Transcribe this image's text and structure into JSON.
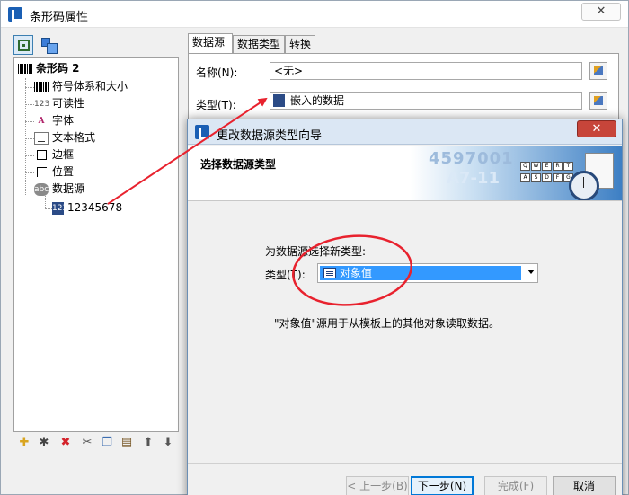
{
  "main_window": {
    "title": "条形码属性",
    "close_glyph": "✕"
  },
  "tree": {
    "root": "条形码 2",
    "items": [
      "符号体系和大小",
      "可读性",
      "字体",
      "文本格式",
      "边框",
      "位置",
      "数据源"
    ],
    "child": "12345678",
    "icon_labels": {
      "readability": "123",
      "font": "A",
      "datasource": "abc",
      "child_doc": "123"
    }
  },
  "tree_bottom_icons": [
    "new-icon",
    "wizard-icon",
    "delete-icon",
    "cut-icon",
    "copy-icon",
    "paste-icon",
    "move-up-icon",
    "move-down-icon"
  ],
  "tree_bottom_glyphs": [
    "✚",
    "✱",
    "✖",
    "✂",
    "❐",
    "▤",
    "⬆",
    "⬇"
  ],
  "tabs": [
    "数据源",
    "数据类型",
    "转换"
  ],
  "fields": {
    "name_label": "名称(N):",
    "name_value": "<无>",
    "type_label": "类型(T):",
    "type_value": "嵌入的数据"
  },
  "wizard": {
    "title": "更改数据源类型向导",
    "close_glyph": "✕",
    "header_title": "选择数据源类型",
    "banner": {
      "num1": "4597001",
      "num2": "A7-11",
      "kbd_row1": [
        "Q",
        "W",
        "E",
        "R",
        "T"
      ],
      "kbd_row2": [
        "A",
        "S",
        "D",
        "F",
        "G"
      ]
    },
    "prompt": "为数据源选择新类型:",
    "type_label": "类型(T):",
    "selected_type": "对象值",
    "description": "\"对象值\"源用于从模板上的其他对象读取数据。",
    "buttons": {
      "back": "< 上一步(B)",
      "next": "下一步(N) >",
      "finish": "完成(F)",
      "cancel": "取消"
    }
  },
  "colors": {
    "selection": "#3399ff",
    "annotation_red": "#e8222e",
    "dialog_close": "#c7453a"
  }
}
